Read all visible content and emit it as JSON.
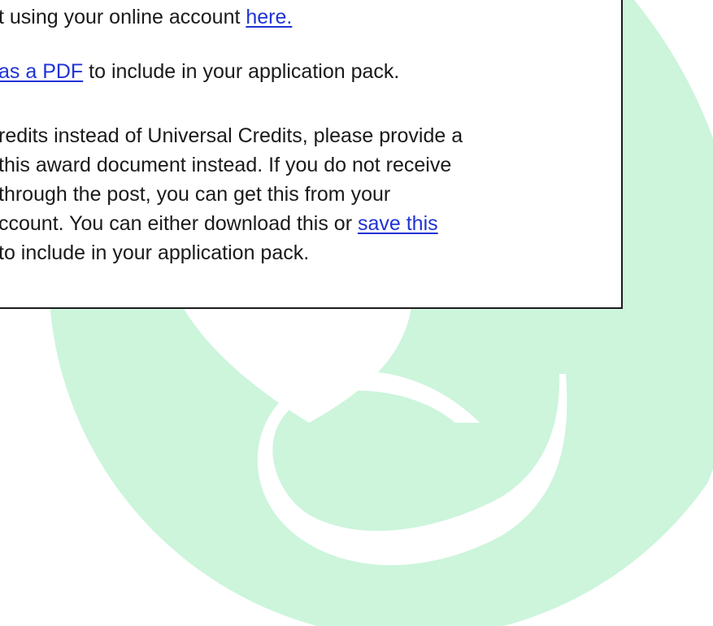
{
  "document": {
    "paragraph_1": {
      "line_1_text": "t using your online account ",
      "line_1_link": "here."
    },
    "paragraph_2": {
      "line_1_link": " as a PDF",
      "line_1_text": " to include in your application pack."
    },
    "paragraph_3": {
      "line_1": "redits instead of Universal Credits, please provide a",
      "line_2": "this award document instead. If you do not receive",
      "line_3": " through the post, you can get this from your",
      "line_4_text": "ccount. You can either download this or ",
      "line_4_link": "save this",
      "line_5": "to include in your application pack."
    }
  },
  "colors": {
    "watermark": "#ccf5dc",
    "link": "#1f33d6",
    "text": "#1a1a1a",
    "border": "#1c1c1c"
  },
  "watermark_icon": "ampersand-logo-icon"
}
